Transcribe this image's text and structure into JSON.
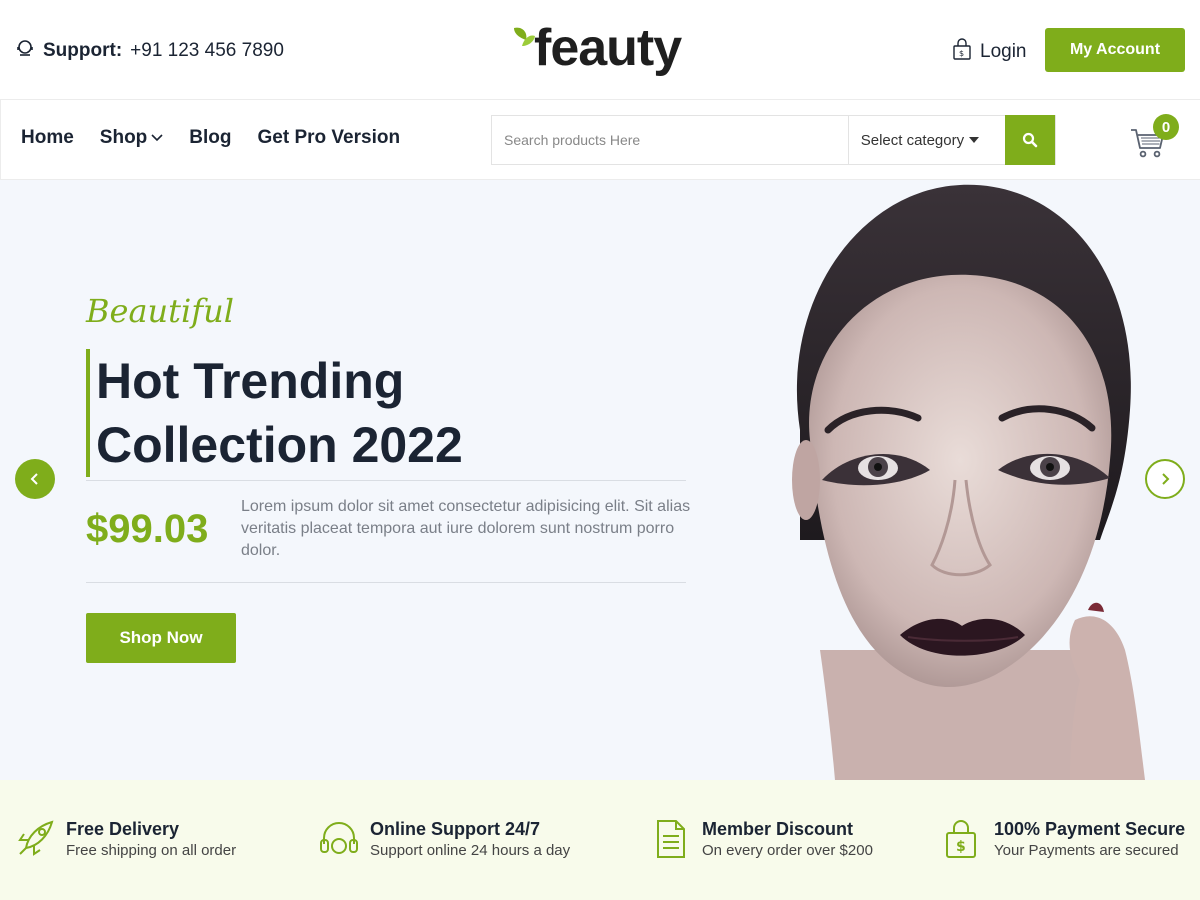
{
  "header": {
    "support_label": "Support:",
    "support_number": "+91 123 456 7890",
    "logo_text": "feauty",
    "login_label": "Login",
    "account_label": "My Account"
  },
  "nav": {
    "items": [
      {
        "label": "Home"
      },
      {
        "label": "Shop"
      },
      {
        "label": "Blog"
      },
      {
        "label": "Get Pro Version"
      }
    ]
  },
  "search": {
    "placeholder": "Search products Here",
    "category_label": "Select category"
  },
  "cart": {
    "count": "0"
  },
  "hero": {
    "script_text": "Beautiful",
    "title_line1": "Hot Trending",
    "title_line2": "Collection 2022",
    "price": "$99.03",
    "description": "Lorem ipsum dolor sit amet consectetur adipisicing elit. Sit alias veritatis placeat tempora aut iure dolorem sunt nostrum porro dolor.",
    "cta_label": "Shop Now"
  },
  "features": [
    {
      "title": "Free Delivery",
      "subtitle": "Free shipping on all order",
      "icon": "rocket-icon"
    },
    {
      "title": "Online Support 24/7",
      "subtitle": "Support online 24 hours a day",
      "icon": "headset-icon"
    },
    {
      "title": "Member Discount",
      "subtitle": "On every order over $200",
      "icon": "document-icon"
    },
    {
      "title": "100% Payment Secure",
      "subtitle": "Your Payments are secured",
      "icon": "secure-bag-icon"
    }
  ],
  "colors": {
    "accent": "#7fad1b",
    "dark_text": "#1b2433",
    "hero_bg": "#f4f7fc",
    "features_bg": "#f8fbeb"
  }
}
